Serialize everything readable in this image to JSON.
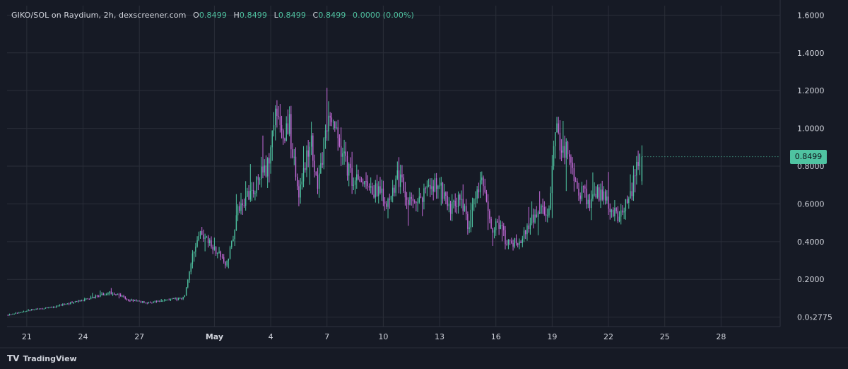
{
  "legend": {
    "symbol": "GIKO/SOL on Raydium, 2h, dexscreener.com",
    "open_label": "O",
    "open": "0.8499",
    "high_label": "H",
    "high": "0.8499",
    "low_label": "L",
    "low": "0.8499",
    "close_label": "C",
    "close": "0.8499",
    "change": "0.0000 (0.00%)"
  },
  "price_tag": "0.8499",
  "brand": {
    "logo_text": "TV",
    "name": "TradingView"
  },
  "colors": {
    "background": "#161a25",
    "up": "#4fc3a1",
    "down": "#c46ad9",
    "grid": "#2a2e39",
    "text": "#d1d4dc"
  },
  "chart_data": {
    "type": "candlestick",
    "y_ticks": [
      "1.6000",
      "1.4000",
      "1.2000",
      "1.0000",
      "0.8000",
      "0.6000",
      "0.4000",
      "0.2000",
      "0.0₅2775"
    ],
    "y_tick_values": [
      1.6,
      1.4,
      1.2,
      1.0,
      0.8,
      0.6,
      0.4,
      0.2,
      0.0
    ],
    "ylim": [
      -0.05,
      1.65
    ],
    "x_ticks": [
      "21",
      "24",
      "27",
      "May",
      "4",
      "7",
      "10",
      "13",
      "16",
      "19",
      "22",
      "25",
      "28"
    ],
    "x_tick_days": [
      0,
      3,
      6,
      10,
      13,
      16,
      19,
      22,
      25,
      28,
      31,
      34,
      37
    ],
    "xlim_days": [
      -1.05,
      40.15
    ],
    "path_anchors_day": [
      -1.0,
      0.0,
      1.5,
      3.0,
      4.5,
      5.5,
      6.5,
      7.5,
      8.4,
      8.8,
      9.3,
      9.8,
      10.7,
      11.2,
      11.6,
      12.3,
      12.9,
      13.2,
      13.6,
      14.0,
      14.5,
      15.1,
      15.5,
      16.0,
      16.6,
      17.2,
      17.8,
      18.5,
      19.2,
      19.8,
      20.5,
      21.2,
      21.8,
      22.5,
      23.2,
      23.5,
      24.2,
      24.8,
      25.2,
      25.6,
      26.0,
      26.3,
      26.6,
      27.1,
      27.8,
      28.2,
      28.7,
      29.4,
      30.0,
      30.6,
      30.9,
      31.3,
      31.6,
      31.9,
      32.2,
      32.7
    ],
    "path_anchors_value": [
      0.012,
      0.035,
      0.055,
      0.09,
      0.13,
      0.09,
      0.075,
      0.095,
      0.1,
      0.33,
      0.44,
      0.38,
      0.28,
      0.55,
      0.62,
      0.72,
      0.82,
      1.12,
      0.94,
      1.02,
      0.62,
      0.96,
      0.68,
      1.05,
      0.94,
      0.75,
      0.7,
      0.68,
      0.62,
      0.74,
      0.6,
      0.65,
      0.73,
      0.58,
      0.62,
      0.48,
      0.72,
      0.45,
      0.5,
      0.38,
      0.4,
      0.37,
      0.46,
      0.55,
      0.56,
      0.98,
      0.9,
      0.68,
      0.62,
      0.66,
      0.6,
      0.56,
      0.53,
      0.6,
      0.67,
      0.85
    ],
    "final_candle": {
      "open": 0.8499,
      "high": 0.8499,
      "low": 0.8499,
      "close": 0.8499
    },
    "candle_interval_hours": 2,
    "up_color": "#4fc3a1",
    "down_color": "#c46ad9",
    "grid": true
  }
}
